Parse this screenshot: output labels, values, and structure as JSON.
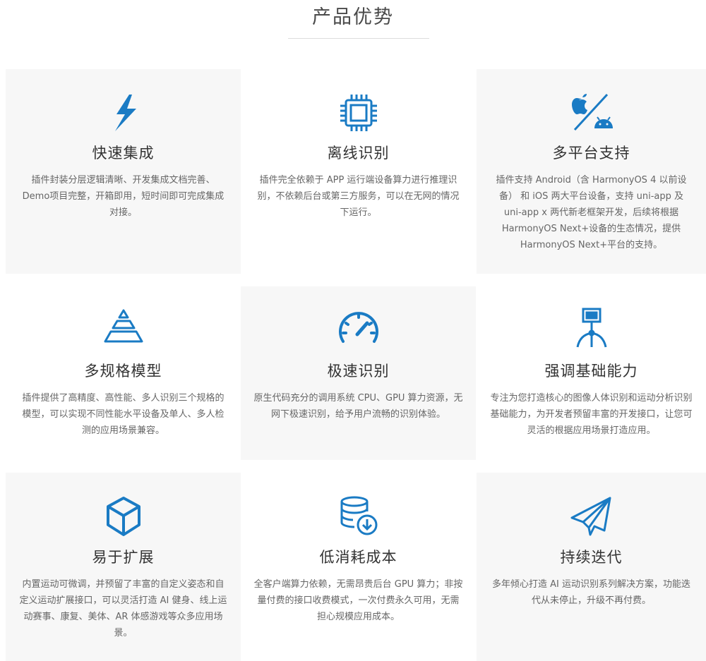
{
  "section": {
    "title": "产品优势"
  },
  "cards": [
    {
      "title": "快速集成",
      "desc": "插件封装分层逻辑清晰、开发集成文档完善、Demo项目完整，开箱即用，短时间即可完成集成对接。",
      "icon": "lightning-icon"
    },
    {
      "title": "离线识别",
      "desc": "插件完全依赖于 APP 运行端设备算力进行推理识别，不依赖后台或第三方服务，可以在无网的情况下运行。",
      "icon": "chip-icon"
    },
    {
      "title": "多平台支持",
      "desc": "插件支持 Android（含 HarmonyOS 4 以前设备） 和 iOS 两大平台设备，支持 uni-app 及 uni-app x 两代新老框架开发，后续将根据 HarmonyOS Next+设备的生态情况，提供 HarmonyOS Next+平台的支持。",
      "icon": "apple-android-icon"
    },
    {
      "title": "多规格模型",
      "desc": "插件提供了高精度、高性能、多人识别三个规格的模型，可以实现不同性能水平设备及单人、多人检测的应用场景兼容。",
      "icon": "pyramid-icon"
    },
    {
      "title": "极速识别",
      "desc": "原生代码充分的调用系统 CPU、GPU 算力资源，无网下极速识别，给予用户流畅的识别体验。",
      "icon": "speedometer-icon"
    },
    {
      "title": "强调基础能力",
      "desc": "专注为您打造核心的图像人体识别和运动分析识别基础能力，为开发者预留丰富的开发接口，让您可灵活的根据应用场景打造应用。",
      "icon": "robot-arm-icon"
    },
    {
      "title": "易于扩展",
      "desc": "内置运动可微调，并预留了丰富的自定义姿态和自定义运动扩展接口，可以灵活打造 AI 健身、线上运动赛事、康复、美体、AR 体感游戏等众多应用场景。",
      "icon": "cube-icon"
    },
    {
      "title": "低消耗成本",
      "desc": "全客户端算力依赖，无需昂贵后台 GPU 算力；非按量付费的接口收费模式，一次付费永久可用，无需担心规模应用成本。",
      "icon": "database-download-icon"
    },
    {
      "title": "持续迭代",
      "desc": "多年倾心打造 AI 运动识别系列解决方案，功能迭代从未停止，升级不再付费。",
      "icon": "paper-plane-icon"
    }
  ],
  "colors": {
    "accent": "#1a7bc4",
    "card_gray": "#f7f7f7",
    "heading": "#333333",
    "text": "#666666"
  }
}
